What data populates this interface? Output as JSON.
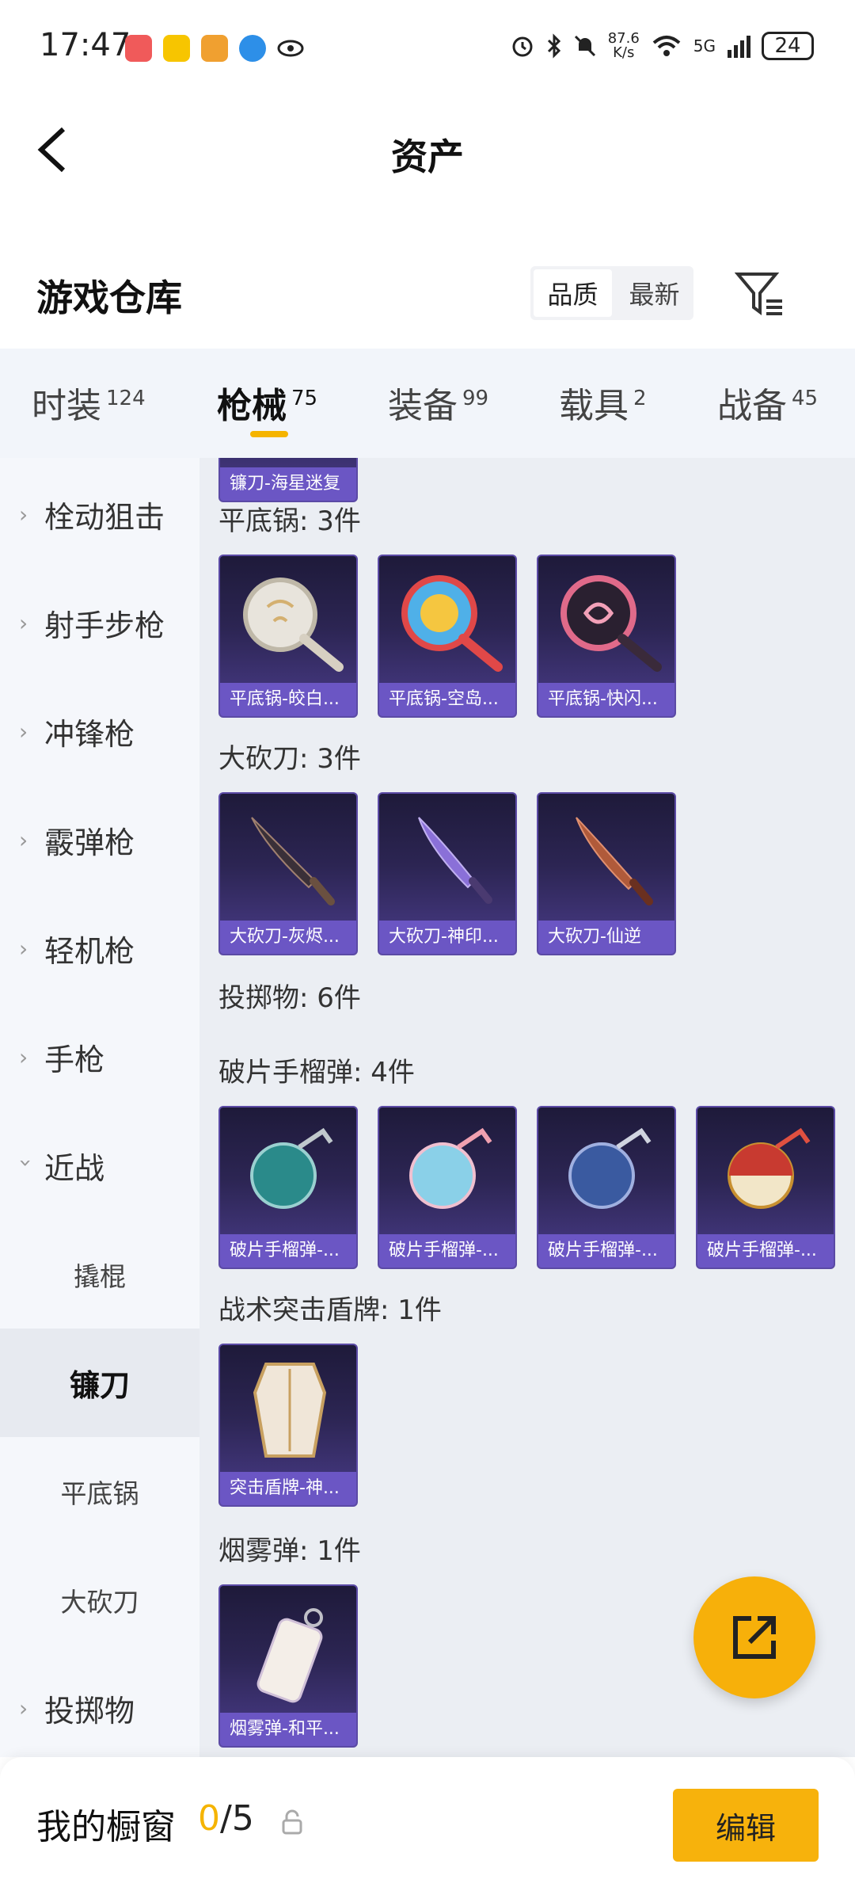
{
  "status_bar": {
    "time": "17:47",
    "net_speed_value": "87.6",
    "net_speed_unit": "K/s",
    "network": "5G",
    "battery": "24"
  },
  "header": {
    "title": "资产"
  },
  "warehouse": {
    "title": "游戏仓库",
    "sort_options": [
      "品质",
      "最新"
    ],
    "active_sort": "品质"
  },
  "tabs": [
    {
      "label": "时装",
      "count": "124"
    },
    {
      "label": "枪械",
      "count": "75"
    },
    {
      "label": "装备",
      "count": "99"
    },
    {
      "label": "载具",
      "count": "2"
    },
    {
      "label": "战备",
      "count": "45"
    }
  ],
  "active_tab": "枪械",
  "sidebar": {
    "categories": [
      "栓动狙击",
      "射手步枪",
      "冲锋枪",
      "霰弹枪",
      "轻机枪",
      "手枪",
      "近战"
    ],
    "subcategories": [
      "撬棍",
      "镰刀",
      "平底锅",
      "大砍刀"
    ],
    "active_sub": "镰刀",
    "after": [
      "投掷物"
    ]
  },
  "content": {
    "partial_card_name": "镰刀-海星迷复",
    "groups": [
      {
        "label": "平底锅: 3件",
        "items": [
          "平底锅-皎白...",
          "平底锅-空岛...",
          "平底锅-快闪..."
        ]
      },
      {
        "label": "大砍刀: 3件",
        "items": [
          "大砍刀-灰烬...",
          "大砍刀-神印...",
          "大砍刀-仙逆"
        ]
      },
      {
        "label": "投掷物: 6件",
        "items": []
      },
      {
        "label": "破片手榴弹: 4件",
        "items": [
          "破片手榴弹-...",
          "破片手榴弹-...",
          "破片手榴弹-...",
          "破片手榴弹-..."
        ]
      },
      {
        "label": "战术突击盾牌: 1件",
        "items": [
          "突击盾牌-神..."
        ]
      },
      {
        "label": "烟雾弹: 1件",
        "items": [
          "烟雾弹-和平..."
        ]
      }
    ]
  },
  "bottom_bar": {
    "label": "我的橱窗",
    "used": "0",
    "total": "/5",
    "edit_label": "编辑"
  },
  "colors": {
    "accent": "#f5b400",
    "card_bg": "#2c2553",
    "card_label": "#6b56c4"
  }
}
